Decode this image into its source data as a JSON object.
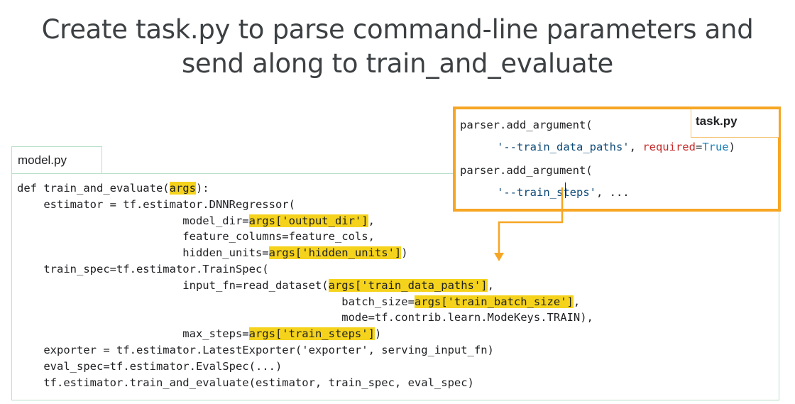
{
  "slide": {
    "title_line1": "Create task.py to parse command-line parameters and",
    "title_line2": "send along to train_and_evaluate"
  },
  "model_panel": {
    "tab_label": "model.py",
    "lines": [
      [
        {
          "t": "def train_and_evaluate("
        },
        {
          "t": "args",
          "h": true
        },
        {
          "t": "):"
        }
      ],
      [
        {
          "t": "    estimator = tf.estimator.DNNRegressor("
        }
      ],
      [
        {
          "t": "                         model_dir="
        },
        {
          "t": "args['output_dir']",
          "h": true
        },
        {
          "t": ","
        }
      ],
      [
        {
          "t": "                         feature_columns=feature_cols,"
        }
      ],
      [
        {
          "t": "                         hidden_units="
        },
        {
          "t": "args['hidden_units']",
          "h": true
        },
        {
          "t": ")"
        }
      ],
      [
        {
          "t": "    train_spec=tf.estimator.TrainSpec("
        }
      ],
      [
        {
          "t": "                         input_fn=read_dataset("
        },
        {
          "t": "args['train_data_paths']",
          "h": true
        },
        {
          "t": ","
        }
      ],
      [
        {
          "t": "                                                 batch_size="
        },
        {
          "t": "args['train_batch_size']",
          "h": true
        },
        {
          "t": ","
        }
      ],
      [
        {
          "t": "                                                 mode=tf.contrib.learn.ModeKeys.TRAIN),"
        }
      ],
      [
        {
          "t": "                         max_steps="
        },
        {
          "t": "args['train_steps']",
          "h": true
        },
        {
          "t": ")"
        }
      ],
      [
        {
          "t": "    exporter = tf.estimator.LatestExporter('exporter', serving_input_fn)"
        }
      ],
      [
        {
          "t": "    eval_spec=tf.estimator.EvalSpec(...)"
        }
      ],
      [
        {
          "t": "    tf.estimator.train_and_evaluate(estimator, train_spec, eval_spec)"
        }
      ]
    ]
  },
  "task_panel": {
    "tab_label": "task.py",
    "line1": "parser.add_argument(",
    "line2_str": "'--train_data_paths'",
    "line2_comma": ", ",
    "line2_kw": "required",
    "line2_eq": "=",
    "line2_bool": "True",
    "line2_close": ")",
    "line3": "parser.add_argument(",
    "line4_str": "'--train_steps'",
    "line4_rest": ", ..."
  },
  "colors": {
    "highlight": "#f5d31c",
    "task_border": "#f6a623",
    "model_border": "#b9dfc8"
  }
}
